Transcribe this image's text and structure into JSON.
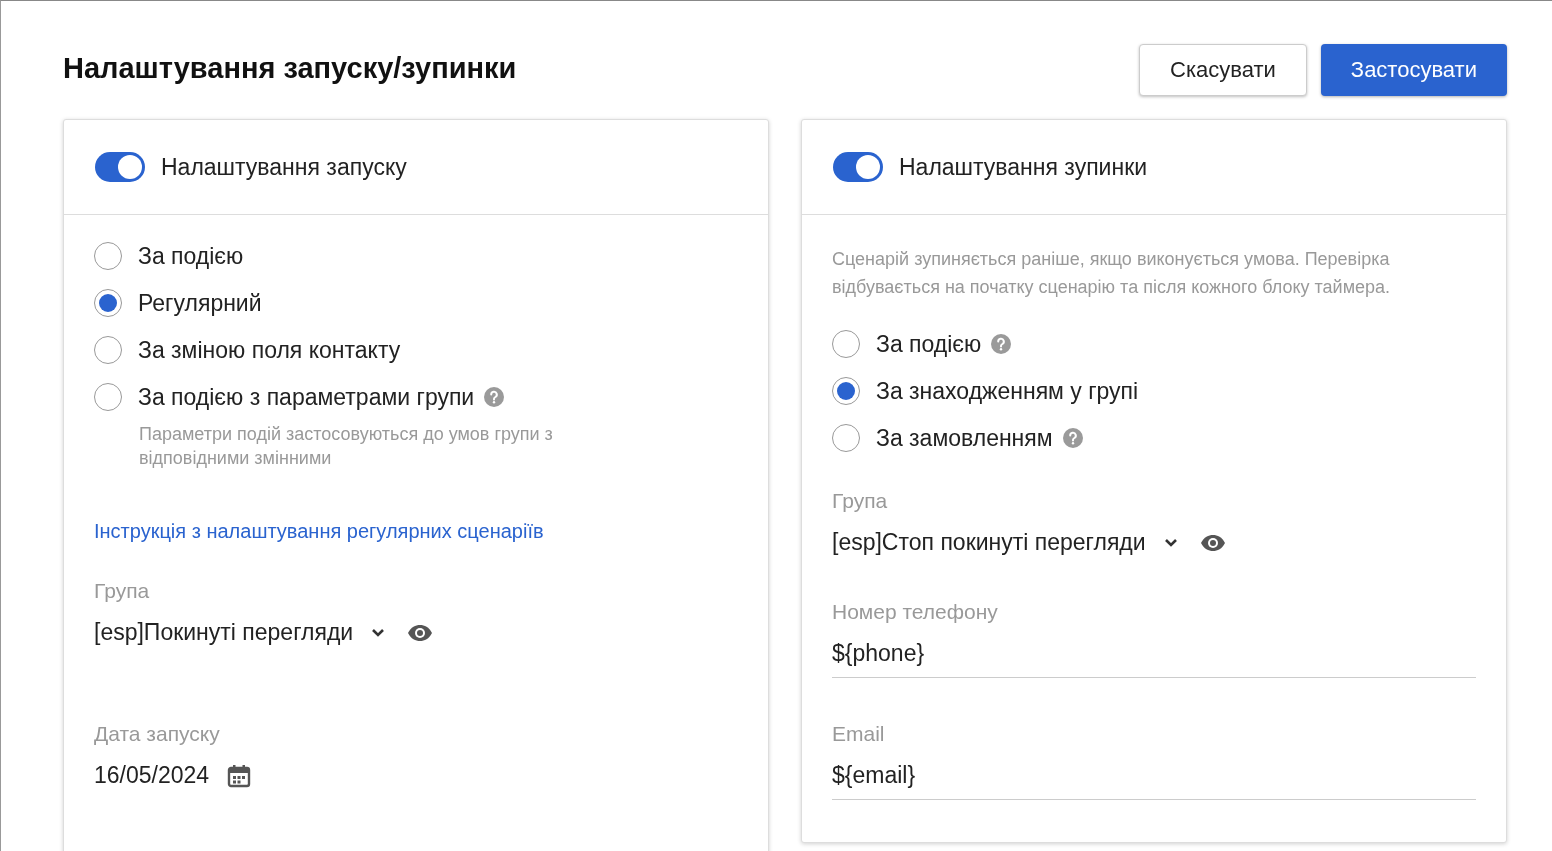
{
  "title": "Налаштування запуску/зупинки",
  "buttons": [
    {
      "label": "Скасувати",
      "kind": "secondary"
    },
    {
      "label": "Застосувати",
      "kind": "primary"
    }
  ],
  "panels": [
    {
      "toggle": {
        "label": "Налаштування запуску",
        "on": true
      },
      "options": [
        {
          "label": "За подією",
          "selected": false,
          "help": false
        },
        {
          "label": "Регулярний",
          "selected": true,
          "help": false
        },
        {
          "label": "За зміною поля контакту",
          "selected": false,
          "help": false
        },
        {
          "label": "За подією з параметрами групи",
          "selected": false,
          "help": true,
          "note": "Параметри подій застосовуються до умов групи з відповідними змінними"
        }
      ],
      "link": "Інструкція з налаштування регулярних сценаріїв",
      "fields": [
        {
          "kind": "select",
          "label": "Група",
          "value": "[esp]Покинуті перегляди"
        },
        {
          "kind": "date",
          "label": "Дата запуску",
          "value": "16/05/2024"
        }
      ]
    },
    {
      "toggle": {
        "label": "Налаштування зупинки",
        "on": true
      },
      "description": "Сценарій зупиняється раніше, якщо виконується умова. Перевірка відбувається на початку сценарію та після кожного блоку таймера.",
      "options": [
        {
          "label": "За подією",
          "selected": false,
          "help": true
        },
        {
          "label": "За знаходженням у групі",
          "selected": true,
          "help": false
        },
        {
          "label": "За замовленням",
          "selected": false,
          "help": true
        }
      ],
      "fields": [
        {
          "kind": "select",
          "label": "Група",
          "value": "[esp]Стоп покинуті перегляди"
        },
        {
          "kind": "text",
          "label": "Номер телефону",
          "value": "${phone}"
        },
        {
          "kind": "text",
          "label": "Email",
          "value": "${email}"
        }
      ]
    }
  ]
}
